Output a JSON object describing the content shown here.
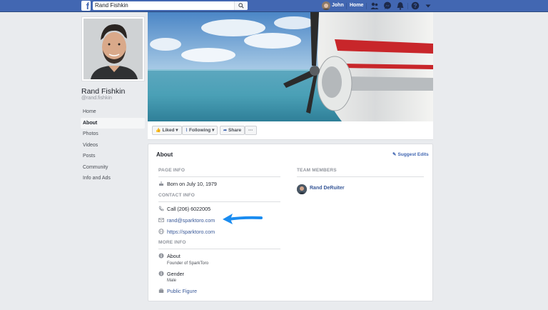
{
  "topbar": {
    "search_value": "Rand Fishkin",
    "user_name": "John",
    "home_label": "Home"
  },
  "profile": {
    "name": "Rand Fishkin",
    "handle": "@rand.fishkin"
  },
  "left_nav": {
    "items": [
      {
        "label": "Home"
      },
      {
        "label": "About"
      },
      {
        "label": "Photos"
      },
      {
        "label": "Videos"
      },
      {
        "label": "Posts"
      },
      {
        "label": "Community"
      },
      {
        "label": "Info and Ads"
      }
    ],
    "active": "About"
  },
  "actions": {
    "liked": "Liked",
    "following": "Following",
    "share": "Share",
    "more": "···"
  },
  "about": {
    "title": "About",
    "suggest_edits": "Suggest Edits",
    "page_info_header": "PAGE INFO",
    "born": "Born on July 10, 1979",
    "contact_info_header": "CONTACT INFO",
    "phone": "Call (206) 6022005",
    "email": "rand@sparktoro.com",
    "website": "https://sparktoro.com",
    "more_info_header": "MORE INFO",
    "about_label": "About",
    "about_value": "Founder of SparkToro",
    "gender_label": "Gender",
    "gender_value": "Male",
    "category": "Public Figure",
    "team_header": "TEAM MEMBERS",
    "team_member": "Rand DeRuiter"
  },
  "colors": {
    "brand_blue": "#4267b2",
    "link_blue": "#385898",
    "annotation_arrow": "#1a8cf0"
  }
}
